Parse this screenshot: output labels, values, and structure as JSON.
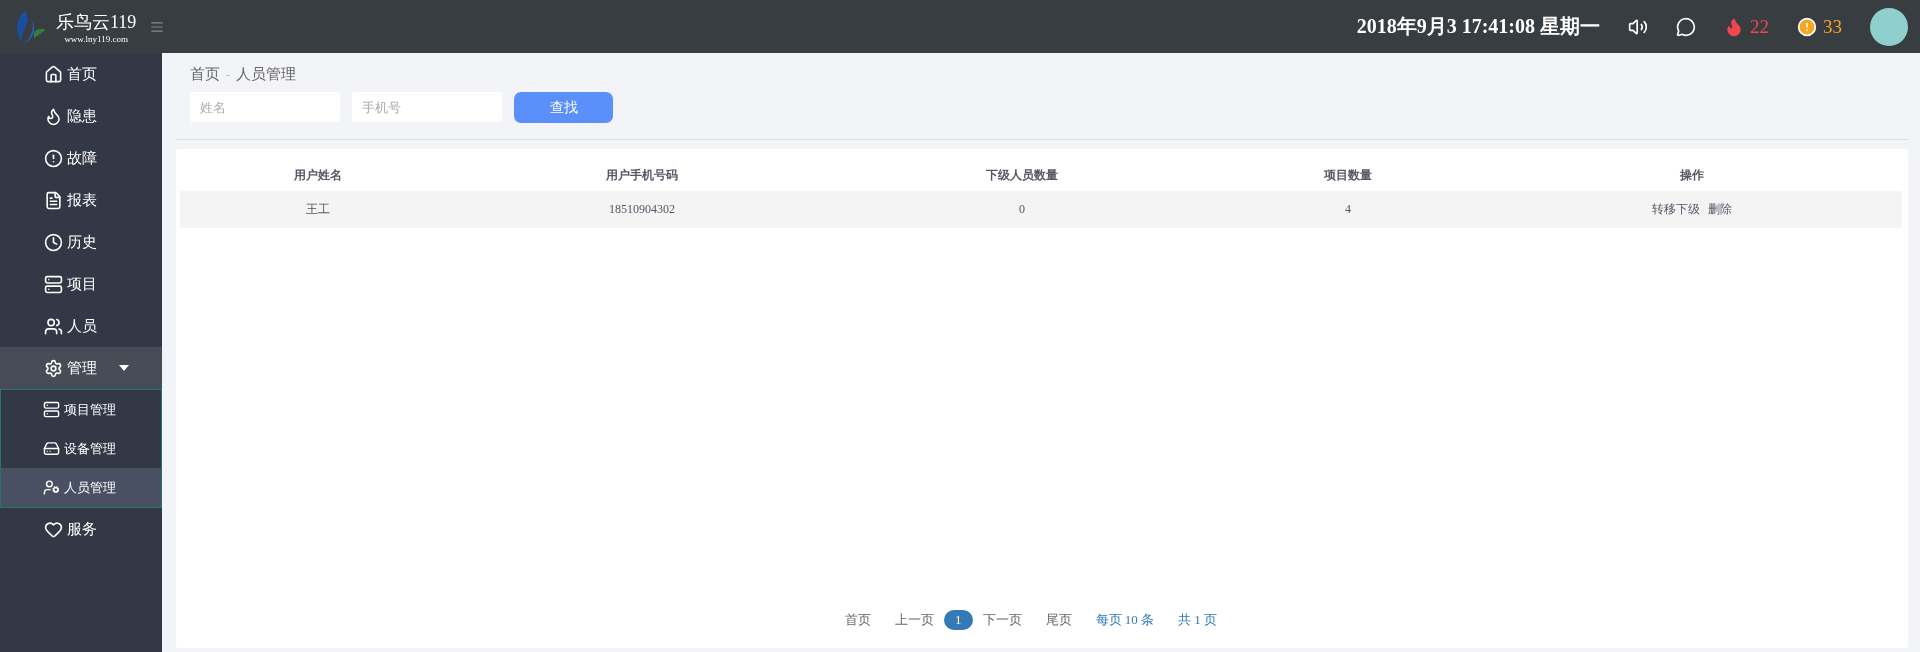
{
  "header": {
    "brand": "乐鸟云119",
    "url": "www.lny119.com",
    "datetime": "2018年9月3 17:41:08 星期一",
    "alerts": [
      {
        "kind": "fire",
        "count": "22",
        "color": "#f0474f"
      },
      {
        "kind": "warning",
        "count": "33",
        "color": "#f5a623"
      }
    ]
  },
  "sidebar": {
    "items": [
      {
        "label": "首页",
        "selected": false
      },
      {
        "label": "隐患",
        "selected": false
      },
      {
        "label": "故障",
        "selected": false
      },
      {
        "label": "报表",
        "selected": false
      },
      {
        "label": "历史",
        "selected": false
      },
      {
        "label": "项目",
        "selected": false
      },
      {
        "label": "人员",
        "selected": false
      },
      {
        "label": "管理",
        "selected": false,
        "expanded": true,
        "children": [
          {
            "label": "项目管理",
            "selected": false
          },
          {
            "label": "设备管理",
            "selected": false
          },
          {
            "label": "人员管理",
            "selected": true
          }
        ]
      },
      {
        "label": "服务",
        "selected": false
      }
    ]
  },
  "breadcrumb": {
    "items": [
      "首页",
      "人员管理"
    ],
    "separator": "-"
  },
  "search": {
    "fields": [
      {
        "placeholder": "姓名"
      },
      {
        "placeholder": "手机号"
      }
    ],
    "button": "查找"
  },
  "table": {
    "columns": [
      "用户姓名",
      "用户手机号码",
      "下级人员数量",
      "项目数量",
      "操作"
    ],
    "rows": [
      {
        "name": "王工",
        "phone": "18510904302",
        "subordinates": "0",
        "projects": "4",
        "actions": [
          "转移下级",
          "删除"
        ]
      }
    ]
  },
  "pagination": {
    "items": [
      {
        "label": "首页",
        "kind": "link"
      },
      {
        "label": "上一页",
        "kind": "link"
      },
      {
        "label": "1",
        "kind": "page",
        "selected": true
      },
      {
        "label": "下一页",
        "kind": "link"
      },
      {
        "label": "尾页",
        "kind": "link"
      },
      {
        "label": "每页 10 条",
        "kind": "info"
      },
      {
        "label": "共 1 页",
        "kind": "info"
      }
    ]
  }
}
